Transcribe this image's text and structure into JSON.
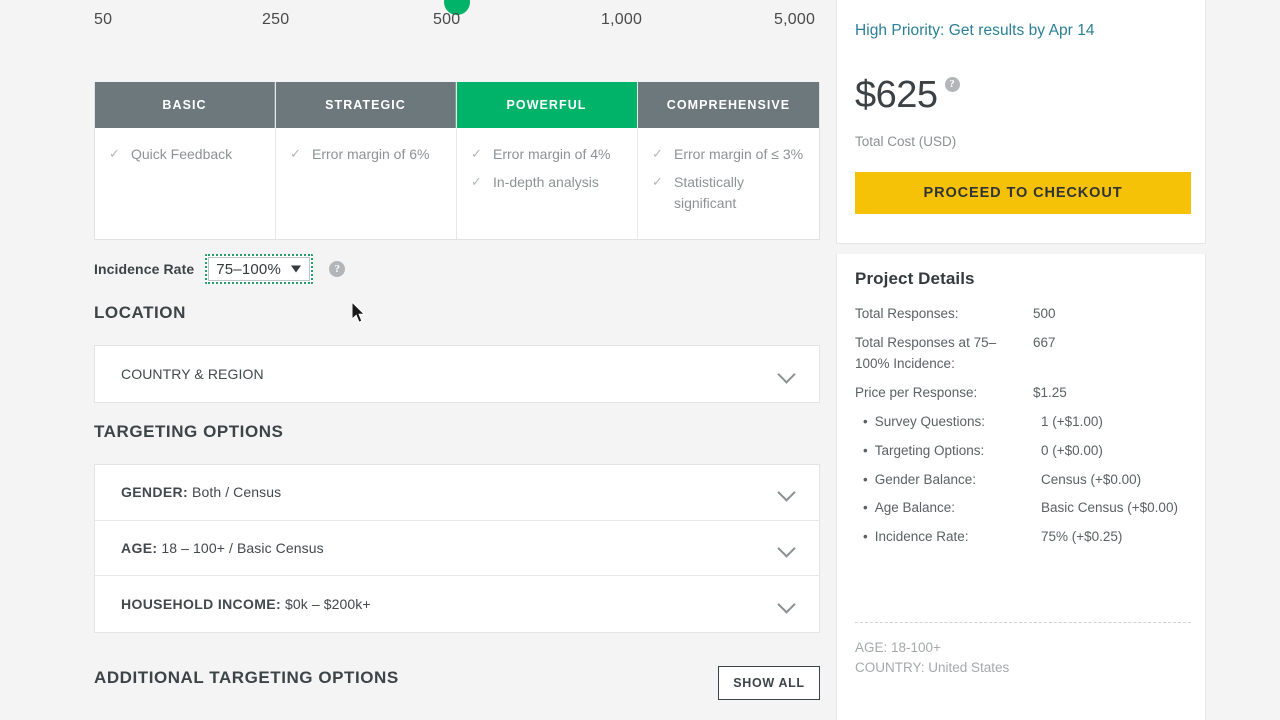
{
  "slider": {
    "ticks": [
      "50",
      "250",
      "1,000",
      "5,000"
    ],
    "selected_tick": "500",
    "handle_color": "#00b368"
  },
  "tiers": [
    {
      "name": "BASIC",
      "active": false,
      "features": [
        "Quick Feedback"
      ]
    },
    {
      "name": "STRATEGIC",
      "active": false,
      "features": [
        "Error margin of 6%"
      ]
    },
    {
      "name": "POWERFUL",
      "active": true,
      "features": [
        "Error margin of 4%",
        "In-depth analysis"
      ]
    },
    {
      "name": "COMPREHENSIVE",
      "active": false,
      "features": [
        "Error margin of ≤ 3%",
        "Statistically significant"
      ]
    }
  ],
  "incidence": {
    "label": "Incidence Rate",
    "value": "75–100%",
    "help_icon": "question-mark-icon"
  },
  "sections": {
    "location": "LOCATION",
    "targeting": "TARGETING OPTIONS",
    "additional": "ADDITIONAL TARGETING OPTIONS"
  },
  "location_rows": [
    {
      "label": "COUNTRY & REGION",
      "value": ""
    }
  ],
  "targeting_rows": [
    {
      "label": "GENDER:",
      "value": "Both / Census"
    },
    {
      "label": "AGE:",
      "value": "18 – 100+ / Basic Census"
    },
    {
      "label": "HOUSEHOLD INCOME:",
      "value": "$0k – $200k+"
    }
  ],
  "show_all_label": "SHOW ALL",
  "panel": {
    "priority_link": "High Priority: Get results by Apr 14",
    "price": "$625",
    "price_sub": "Total Cost (USD)",
    "checkout_label": "PROCEED TO CHECKOUT",
    "price_help_icon": "question-mark-icon",
    "details_title": "Project Details",
    "details": [
      {
        "key": "Total Responses:",
        "value": "500",
        "bullet": false
      },
      {
        "key": "Total Responses at 75–100% Incidence:",
        "value": "667",
        "bullet": false
      },
      {
        "key": "Price per Response:",
        "value": "$1.25",
        "bullet": false
      },
      {
        "key": "Survey Questions:",
        "value": "1 (+$1.00)",
        "bullet": true
      },
      {
        "key": "Targeting Options:",
        "value": "0 (+$0.00)",
        "bullet": true
      },
      {
        "key": "Gender Balance:",
        "value": "Census (+$0.00)",
        "bullet": true
      },
      {
        "key": "Age Balance:",
        "value": "Basic Census (+$0.00)",
        "bullet": true
      },
      {
        "key": "Incidence Rate:",
        "value": "75% (+$0.25)",
        "bullet": true
      }
    ],
    "summary": [
      "AGE: 18-100+",
      "COUNTRY: United States"
    ]
  },
  "colors": {
    "accent_green": "#00b368",
    "tier_gray": "#6d787c",
    "checkout_yellow": "#f5c207",
    "link_teal": "#2a7f95",
    "page_bg": "#f4f4f4"
  }
}
